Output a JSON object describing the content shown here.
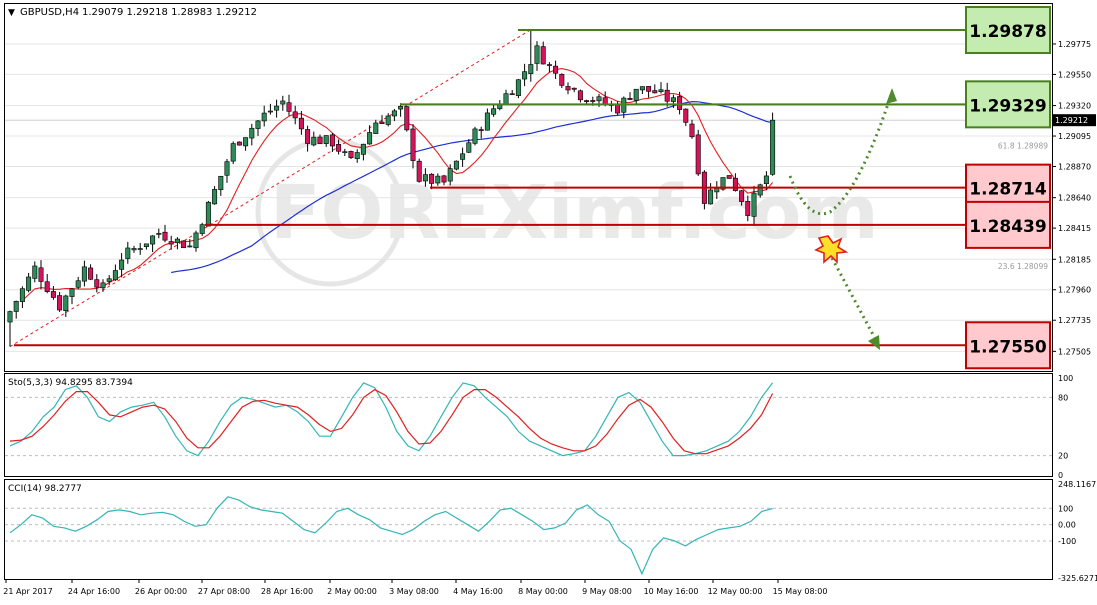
{
  "header": {
    "symbol": "GBPUSD,H4",
    "ohlc": "1.29079 1.29218 1.28983 1.29212"
  },
  "watermark": "FOREXimf.com",
  "colors": {
    "bull": "#2e8b57",
    "bear": "#d4145a",
    "ma_fast": "#e02020",
    "ma_slow": "#1d2fd6",
    "resistance_line": "#4a7f1e",
    "support_line": "#c00000",
    "resistance_box_fill": "#c5ecb0",
    "support_box_fill": "#ffc9ce",
    "stoch_main": "#35b5b5",
    "stoch_signal": "#e02020",
    "cci": "#35b5b5",
    "arrow": "#4f8a2b"
  },
  "levels": {
    "resistance": [
      "1.29878",
      "1.29329"
    ],
    "support": [
      "1.28714",
      "1.28439",
      "1.27550"
    ]
  },
  "chart_data": [
    {
      "type": "candlestick",
      "title": "GBPUSD,H4",
      "ylim": [
        1.2736,
        1.3007
      ],
      "y_ticks": [
        "1.29775",
        "1.29550",
        "1.29320",
        "1.29095",
        "1.28870",
        "1.28640",
        "1.28415",
        "1.28185",
        "1.27960",
        "1.27735",
        "1.27505"
      ],
      "current_price": "1.29212",
      "fib_labels": [
        "61.8 1.28989",
        "23.6 1.28099"
      ],
      "x_labels": [
        "21 Apr 2017",
        "24 Apr 16:00",
        "26 Apr 00:00",
        "27 Apr 08:00",
        "28 Apr 16:00",
        "2 May 00:00",
        "3 May 08:00",
        "4 May 16:00",
        "8 May 00:00",
        "9 May 08:00",
        "10 May 16:00",
        "12 May 00:00",
        "15 May 08:00"
      ],
      "key_points": {
        "bar0_low": 1.2754,
        "peak_high": 1.2988,
        "recent_low": 1.2843,
        "last_close": 1.29212
      },
      "levels": [
        1.29878,
        1.29329,
        1.28714,
        1.28439,
        1.2755
      ],
      "scenarios": [
        "up to 1.29329",
        "down to 1.27550"
      ]
    },
    {
      "type": "line",
      "title": "Sto(5,3,3) 94.8295 83.7394",
      "ylim": [
        0,
        100
      ],
      "y_ticks": [
        "100",
        "80",
        "20",
        "0"
      ],
      "series": [
        {
          "values": [
            30,
            35,
            45,
            60,
            70,
            88,
            92,
            80,
            60,
            55,
            65,
            70,
            72,
            75,
            60,
            40,
            25,
            20,
            35,
            55,
            72,
            80,
            78,
            74,
            70,
            72,
            65,
            55,
            40,
            40,
            60,
            80,
            95,
            90,
            70,
            45,
            30,
            25,
            40,
            60,
            80,
            95,
            92,
            80,
            70,
            60,
            45,
            35,
            30,
            25,
            20,
            22,
            25,
            40,
            60,
            80,
            85,
            75,
            55,
            35,
            20,
            20,
            22,
            25,
            30,
            35,
            45,
            60,
            80,
            95
          ]
        },
        {
          "values": [
            35,
            36,
            40,
            50,
            62,
            76,
            86,
            86,
            75,
            62,
            60,
            65,
            70,
            72,
            68,
            55,
            38,
            28,
            28,
            40,
            55,
            70,
            76,
            77,
            74,
            72,
            70,
            62,
            52,
            45,
            48,
            62,
            80,
            88,
            82,
            65,
            45,
            32,
            33,
            45,
            62,
            80,
            88,
            88,
            80,
            70,
            60,
            48,
            38,
            32,
            28,
            25,
            25,
            30,
            42,
            58,
            72,
            78,
            70,
            55,
            38,
            25,
            22,
            22,
            26,
            30,
            38,
            48,
            62,
            84
          ]
        }
      ]
    },
    {
      "type": "line",
      "title": "CCI(14) 98.2777",
      "ylim": [
        -325.6271,
        248.1167
      ],
      "y_ticks": [
        "248.1167",
        "100",
        "0.00",
        "-100",
        "-325.6271"
      ],
      "series": [
        {
          "values": [
            -50,
            0,
            60,
            40,
            -10,
            -20,
            -40,
            -10,
            30,
            80,
            90,
            80,
            60,
            70,
            75,
            60,
            20,
            -10,
            0,
            100,
            170,
            150,
            110,
            90,
            80,
            70,
            20,
            -30,
            -50,
            10,
            80,
            100,
            60,
            30,
            -20,
            -40,
            -60,
            -30,
            20,
            60,
            80,
            40,
            0,
            -40,
            20,
            90,
            100,
            60,
            20,
            -30,
            -20,
            10,
            90,
            120,
            60,
            20,
            -100,
            -150,
            -300,
            -150,
            -80,
            -100,
            -130,
            -90,
            -60,
            -30,
            -20,
            -10,
            20,
            80,
            98.2777
          ]
        }
      ]
    }
  ]
}
